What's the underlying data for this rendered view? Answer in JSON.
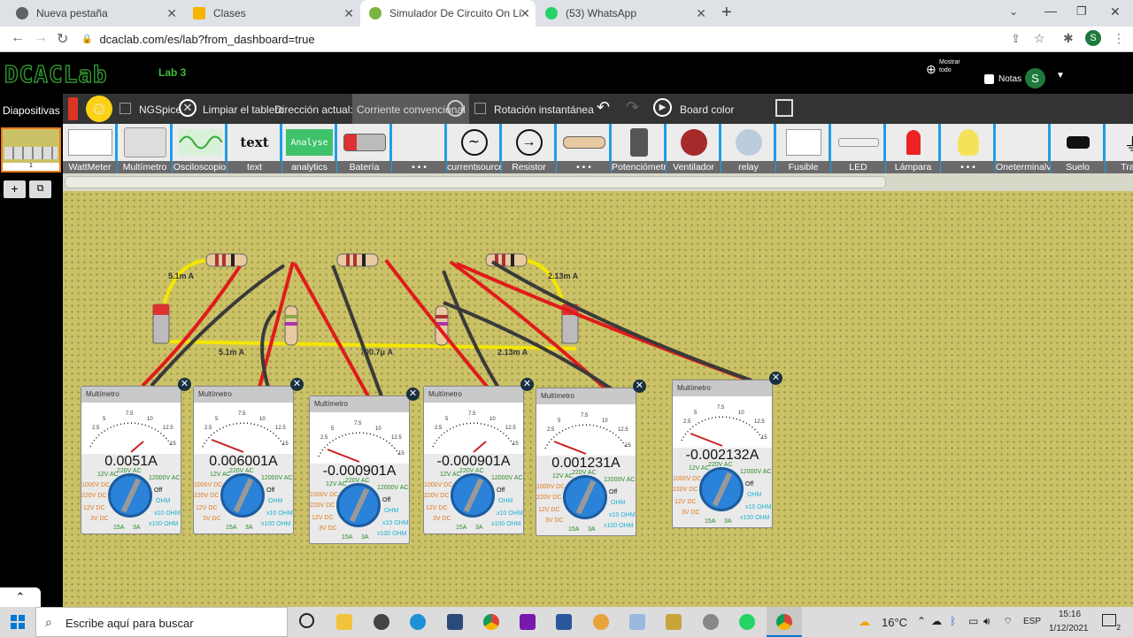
{
  "browser": {
    "tabs": [
      {
        "label": "Nueva pestaña",
        "color": "#5f6368"
      },
      {
        "label": "Clases",
        "color": "#f4b400"
      },
      {
        "label": "Simulador De Circuito On Línea |",
        "color": "#7cb342"
      },
      {
        "label": "(53) WhatsApp",
        "color": "#25d366"
      }
    ],
    "url": "dcaclab.com/es/lab?from_dashboard=true",
    "profile": "S"
  },
  "app": {
    "logo": "DCACLab",
    "lab_title": "Lab 3",
    "show_all": "Mostrar todo",
    "notes_label": "Notas",
    "profile": "S"
  },
  "sidebar": {
    "title": "Diapositivas",
    "slide_number": "1",
    "add": "+",
    "copy": "⧉"
  },
  "toolbar": {
    "ngspice": "NGSpice",
    "clear": "Limpiar el tablero",
    "direction": "Dirección actual:",
    "direction_value": "Corriente convencional",
    "instant_rotation": "Rotación instantánea",
    "board_color": "Board color"
  },
  "palette": [
    {
      "label": "WattMeter"
    },
    {
      "label": "Multímetro"
    },
    {
      "label": "Osciloscopio"
    },
    {
      "label": "text",
      "img": "text"
    },
    {
      "label": "analytics",
      "img": "Analyse"
    },
    {
      "label": "Batería"
    },
    {
      "label": "• • •"
    },
    {
      "label": "currentsource"
    },
    {
      "label": "Resistor"
    },
    {
      "label": "• • •"
    },
    {
      "label": "Potenciómetro"
    },
    {
      "label": "Ventilador"
    },
    {
      "label": "relay"
    },
    {
      "label": "Fusible"
    },
    {
      "label": "LED"
    },
    {
      "label": "Lámpara"
    },
    {
      "label": "• • •"
    },
    {
      "label": "Oneterminalvo"
    },
    {
      "label": "Suelo"
    },
    {
      "label": "Trans"
    }
  ],
  "circuit": {
    "labels": [
      "5.1m A",
      "2.13m A",
      "5.1m A",
      "700.7μ A",
      "2.13m A"
    ]
  },
  "multimeters": [
    {
      "title": "Multímetro",
      "reading": "0.0051A"
    },
    {
      "title": "Multímetro",
      "reading": "0.006001A"
    },
    {
      "title": "Multímetro",
      "reading": "-0.000901A"
    },
    {
      "title": "Multímetro",
      "reading": "-0.000901A"
    },
    {
      "title": "Multímetro",
      "reading": "0.001231A"
    },
    {
      "title": "Multímetro",
      "reading": "-0.002132A"
    }
  ],
  "dial": {
    "scale": [
      "2.5",
      "5",
      "7.5",
      "10",
      "12.5",
      "15"
    ],
    "ranges": [
      "12V AC",
      "220V AC",
      "12000V AC",
      "1000V DC",
      "220V DC",
      "12V DC",
      "3V DC",
      "15A",
      "3A",
      "Off",
      "OHM",
      "x10 OHM",
      "x100 OHM"
    ]
  },
  "taskbar": {
    "search_placeholder": "Escribe aquí para buscar",
    "temperature": "16°C",
    "lang": "ESP",
    "time": "15:16",
    "date": "1/12/2021",
    "notif": "2"
  }
}
